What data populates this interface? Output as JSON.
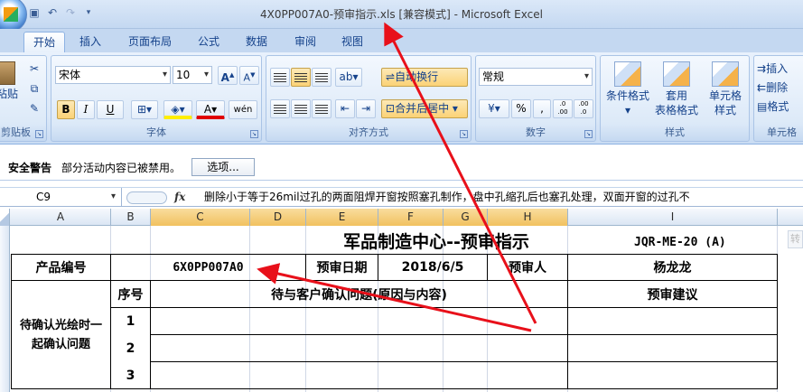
{
  "window": {
    "title": "4X0PP007A0-预审指示.xls  [兼容模式] - Microsoft Excel"
  },
  "ribbon_tabs": [
    {
      "label": "开始",
      "active": true
    },
    {
      "label": "插入"
    },
    {
      "label": "页面布局"
    },
    {
      "label": "公式"
    },
    {
      "label": "数据"
    },
    {
      "label": "审阅"
    },
    {
      "label": "视图"
    }
  ],
  "ribbon": {
    "clipboard": {
      "paste": "粘贴",
      "label": "剪贴板"
    },
    "font": {
      "name": "宋体",
      "size": "10",
      "bold": "B",
      "italic": "I",
      "underline": "U",
      "label": "字体",
      "font_color": "A",
      "phonetic": "wén"
    },
    "alignment": {
      "wrap_text": "自动换行",
      "merge_center": "合并后居中",
      "label": "对齐方式"
    },
    "number": {
      "format": "常规",
      "label": "数字",
      "percent": "%",
      "comma": ",",
      "inc_decimal": ".0 .00",
      "dec_decimal": ".00 .0"
    },
    "styles": {
      "conditional": "条件格式",
      "table_format_1": "套用",
      "table_format_2": "表格格式",
      "cell_styles_1": "单元格",
      "cell_styles_2": "样式",
      "label": "样式"
    },
    "cells": {
      "insert": "插入",
      "delete": "删除",
      "format": "格式",
      "label": "单元格"
    }
  },
  "security_bar": {
    "title": "安全警告",
    "message": "部分活动内容已被禁用。",
    "options_button": "选项..."
  },
  "formula_bar": {
    "name_box": "C9",
    "fx": "fx",
    "content": "删除小于等于26mil过孔的两面阻焊开窗按照塞孔制作，盘中孔缩孔后也塞孔处理，双面开窗的过孔不"
  },
  "columns": [
    "A",
    "B",
    "C",
    "D",
    "E",
    "F",
    "G",
    "H",
    "I"
  ],
  "sheet": {
    "header_title": "军品制造中心--预审指示",
    "doc_code": "JQR-ME-20 (A)",
    "product_no_label": "产品编号",
    "product_no_value": "6X0PP007A0",
    "review_date_label": "预审日期",
    "review_date_value": "2018/6/5",
    "reviewer_label": "预审人",
    "reviewer_value": "杨龙龙",
    "side_label": "待确认光绘时一起确认问题",
    "seq_header": "序号",
    "issue_header": "待与客户确认问题(原因与内容)",
    "advice_header": "预审建议",
    "rows": [
      "1",
      "2",
      "3"
    ]
  },
  "annotation_color": "#e8101a"
}
